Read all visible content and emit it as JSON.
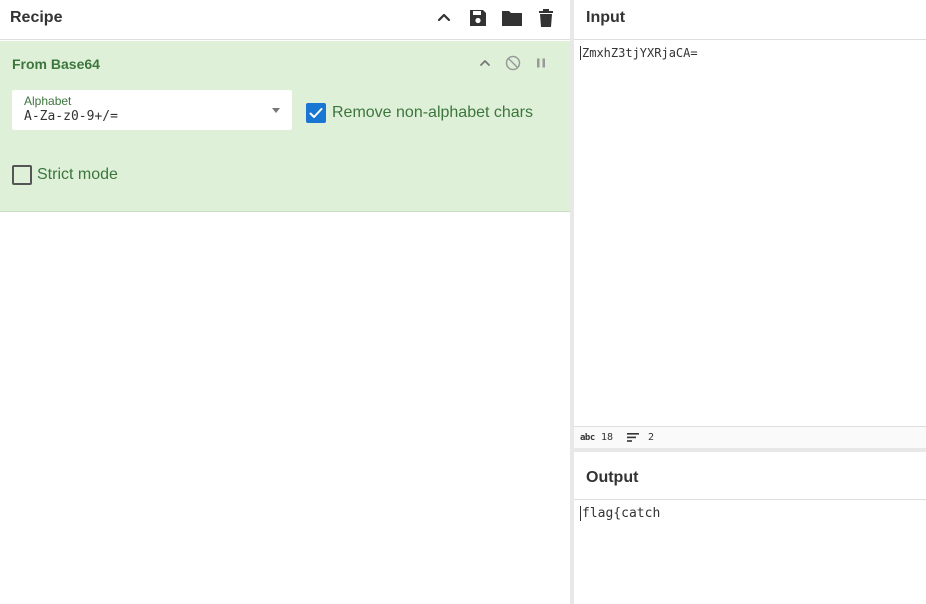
{
  "recipe": {
    "title": "Recipe",
    "toolbar_icons": [
      "collapse-icon",
      "save-icon",
      "folder-icon",
      "trash-icon"
    ]
  },
  "operation": {
    "title": "From Base64",
    "alphabet_label": "Alphabet",
    "alphabet_value": "A-Za-z0-9+/=",
    "remove_non_alphabet_label": "Remove non-alphabet chars",
    "remove_non_alphabet_checked": true,
    "strict_mode_label": "Strict mode",
    "strict_mode_checked": false
  },
  "input": {
    "title": "Input",
    "text": "ZmxhZ3tjYXRjaCA=",
    "status_chars_icon": "abc",
    "status_chars": "18",
    "status_lines": "2"
  },
  "output": {
    "title": "Output",
    "text": "flag{catch"
  },
  "colors": {
    "operation_bg": "#dff0d8",
    "operation_text": "#3c763d",
    "checkbox_accent": "#1976d2"
  }
}
